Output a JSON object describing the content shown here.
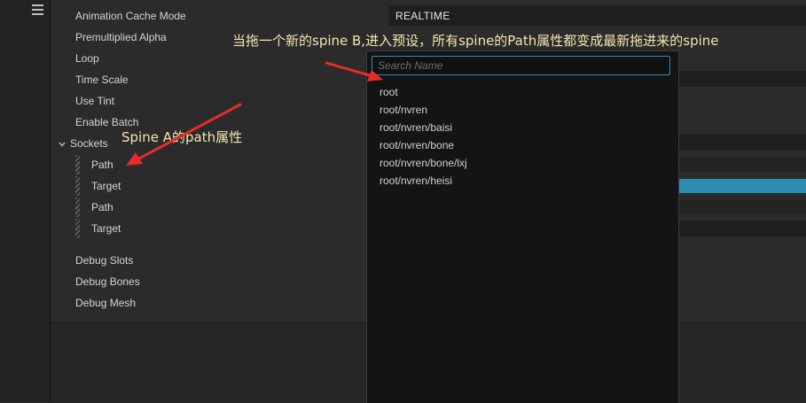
{
  "properties": {
    "animation_cache_mode": "Animation Cache Mode",
    "premultiplied_alpha": "Premultiplied Alpha",
    "loop": "Loop",
    "time_scale": "Time Scale",
    "use_tint": "Use Tint",
    "enable_batch": "Enable Batch",
    "sockets": "Sockets",
    "socket_items": [
      "Path",
      "Target",
      "Path",
      "Target"
    ],
    "debug_slots": "Debug Slots",
    "debug_bones": "Debug Bones",
    "debug_mesh": "Debug Mesh"
  },
  "animation_cache_value": "REALTIME",
  "dropdown": {
    "search_placeholder": "Search Name",
    "options": [
      "root",
      "root/nvren",
      "root/nvren/baisi",
      "root/nvren/bone",
      "root/nvren/bone/lxj",
      "root/nvren/heisi"
    ]
  },
  "annotations": {
    "top_note": "当拖一个新的spine B,进入预设，所有spine的Path属性都变成最新拖进来的spine",
    "side_note": "Spine A的path属性",
    "arrow_color": "#e52b2b"
  },
  "colors": {
    "accent": "#2f8fb8",
    "slider_fill": "#2b8cb0"
  }
}
